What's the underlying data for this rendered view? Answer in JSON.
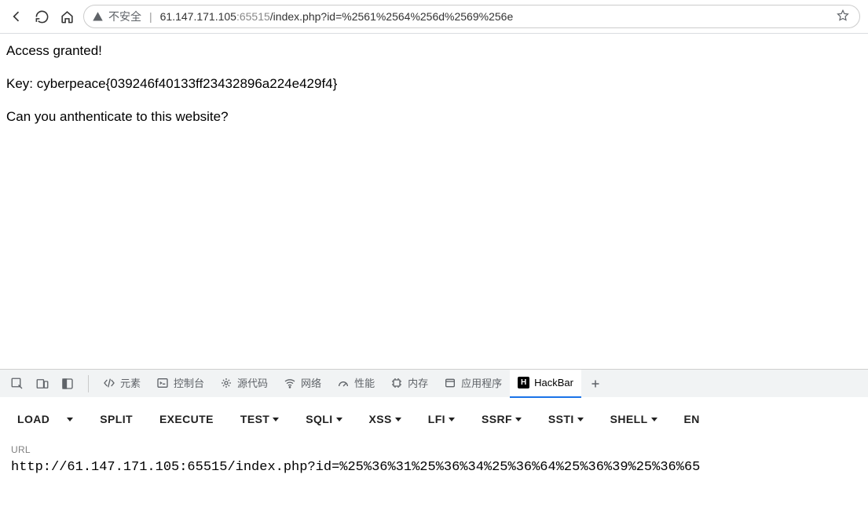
{
  "address": {
    "insecure_label": "不安全",
    "url_host": "61.147.171.105",
    "url_port": ":65515",
    "url_rest": "/index.php?id=%2561%2564%256d%2569%256e"
  },
  "page": {
    "line1": "Access granted!",
    "line2": "Key: cyberpeace{039246f40133ff23432896a224e429f4}",
    "line3": "Can you anthenticate to this website?"
  },
  "devtools_tabs": {
    "elements": "元素",
    "console": "控制台",
    "sources": "源代码",
    "network": "网络",
    "performance": "性能",
    "memory": "内存",
    "application": "应用程序",
    "hackbar": "HackBar"
  },
  "hackbar": {
    "buttons": {
      "load": "LOAD",
      "split": "SPLIT",
      "execute": "EXECUTE",
      "test": "TEST",
      "sqli": "SQLI",
      "xss": "XSS",
      "lfi": "LFI",
      "ssrf": "SSRF",
      "ssti": "SSTI",
      "shell": "SHELL",
      "en": "EN"
    },
    "url_label": "URL",
    "url_value": "http://61.147.171.105:65515/index.php?id=%25%36%31%25%36%34%25%36%64%25%36%39%25%36%65"
  }
}
